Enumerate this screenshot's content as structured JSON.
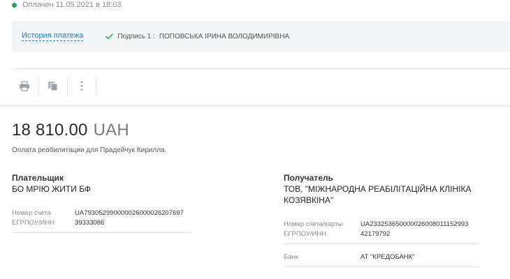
{
  "status": {
    "text": "Оплачен 11.05.2021 в 18:03",
    "color": "#27a35a"
  },
  "history": {
    "link_label": "История платежа",
    "signature_label": "Подпись 1 :",
    "signature_name": "ПОПОВСЬКА ІРИНА ВОЛОДИМИРІВНА"
  },
  "toolbar": {
    "icons": [
      "print-icon",
      "copy-icon",
      "more-vertical-icon"
    ]
  },
  "payment": {
    "amount": "18 810.00",
    "currency": "UAH",
    "purpose": "Оплата реабилитации для Прадейчук Кирилла."
  },
  "payer": {
    "heading": "Плательщик",
    "name": "БО МРІЮ ЖИТИ БФ",
    "rows": [
      {
        "label": "Номер счета",
        "value": "UA793052990000026000026207697"
      },
      {
        "label": "ЕГРПОУ/ИНН",
        "value": "39333086"
      }
    ]
  },
  "receiver": {
    "heading": "Получатель",
    "name": "ТОВ, \"МІЖНАРОДНА РЕАБІЛІТАЦІЙНА КЛІНІКА КОЗЯВКІНА\"",
    "rows": [
      {
        "label": "Номер счета/карты",
        "value": "UA233253650000026008011152993"
      },
      {
        "label": "ЕГРПОУ/ИНН",
        "value": "42179792"
      }
    ],
    "bank": {
      "label": "Банк",
      "value": "АТ \"КРЕДОБАНК\""
    }
  }
}
